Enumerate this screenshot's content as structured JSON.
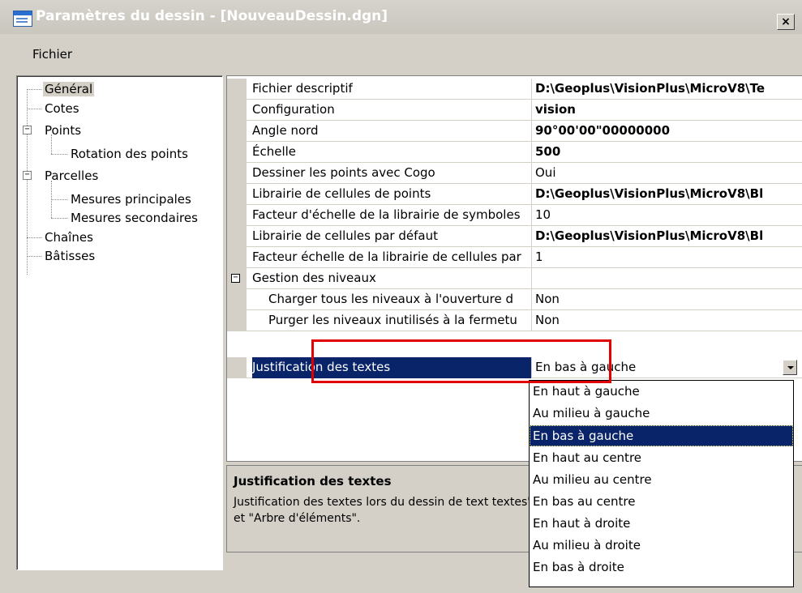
{
  "window": {
    "title": "Paramètres du dessin - [NouveauDessin.dgn]",
    "close_symbol": "×"
  },
  "menu": {
    "file": "Fichier"
  },
  "tree": {
    "items": [
      {
        "label": "Général",
        "selected": true
      },
      {
        "label": "Cotes"
      },
      {
        "label": "Points",
        "expander": "−"
      },
      {
        "label": "Rotation des points"
      },
      {
        "label": "Parcelles",
        "expander": "−"
      },
      {
        "label": "Mesures principales"
      },
      {
        "label": "Mesures secondaires"
      },
      {
        "label": "Chaînes"
      },
      {
        "label": "Bâtisses"
      }
    ]
  },
  "properties": {
    "rows": [
      {
        "name": "Fichier descriptif",
        "value": "D:\\Geoplus\\VisionPlus\\MicroV8\\Te"
      },
      {
        "name": "Configuration",
        "value": "vision"
      },
      {
        "name": "Angle nord",
        "value": "90°00'00\"00000000"
      },
      {
        "name": "Échelle",
        "value": "500"
      },
      {
        "name": "Dessiner les points avec Cogo",
        "value": "Oui"
      },
      {
        "name": "Librairie de cellules de points",
        "value": "D:\\Geoplus\\VisionPlus\\MicroV8\\Bl"
      },
      {
        "name": "Facteur d'échelle de la librairie de symboles",
        "value": "10"
      },
      {
        "name": "Librairie de cellules par défaut",
        "value": "D:\\Geoplus\\VisionPlus\\MicroV8\\Bl"
      },
      {
        "name": "Facteur échelle de la librairie de cellules par",
        "value": "1"
      },
      {
        "name": "Gestion des niveaux",
        "value": "",
        "expander": "−"
      },
      {
        "name": "Charger tous les niveaux à l'ouverture d",
        "value": "Non"
      },
      {
        "name": "Purger les niveaux inutilisés à la fermetu",
        "value": "Non"
      },
      {
        "name": "Justification des textes",
        "value": "En bas à gauche"
      }
    ]
  },
  "description": {
    "title": "Justification des textes",
    "text": "Justification des textes lors du dessin de text textes\" et \"Arbre d'éléments\"."
  },
  "dropdown": {
    "options": [
      "En haut à gauche",
      "Au milieu à gauche",
      "En bas à gauche",
      "En haut au centre",
      "Au milieu au centre",
      "En bas au centre",
      "En haut à droite",
      "Au milieu à droite",
      "En bas à droite"
    ],
    "selected": "En bas à gauche"
  },
  "annotation_color": "#e00000"
}
